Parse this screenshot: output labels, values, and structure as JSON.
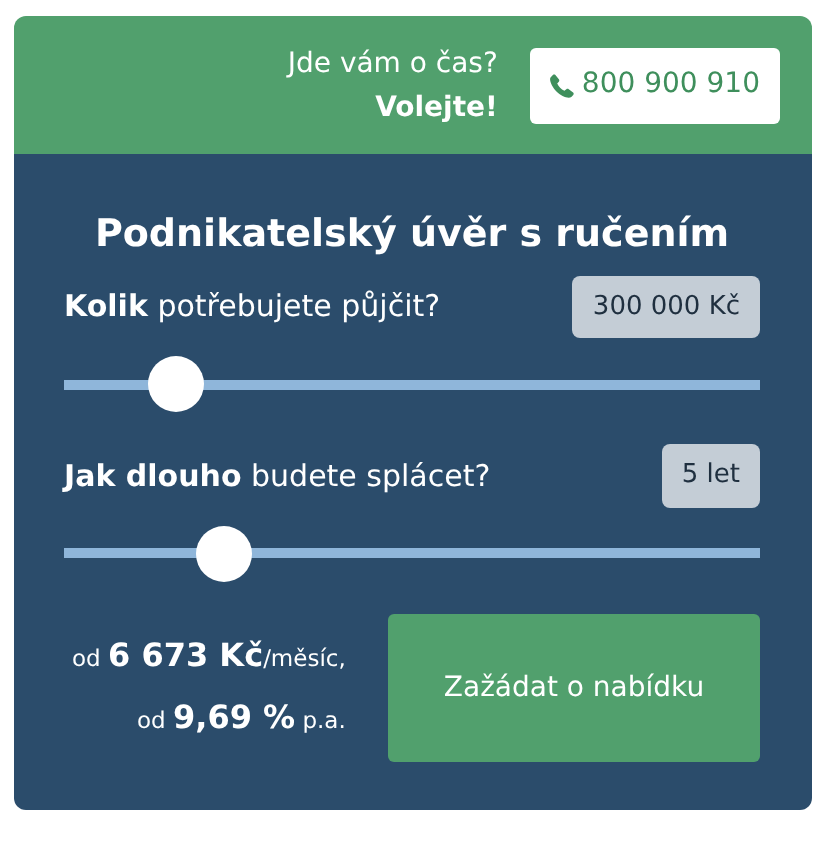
{
  "header": {
    "question": "Jde vám o čas?",
    "call_to_action": "Volejte!",
    "phone": "800 900 910"
  },
  "title": "Podnikatelský úvěr s ručením",
  "sliders": [
    {
      "label": "**Kolik** potřebujete půjčit?",
      "value": "300 000 Kč",
      "level": 0.16
    },
    {
      "label": "**Jak dlouho** budete splácet?",
      "value": "5 let",
      "level": 0.23
    }
  ],
  "summary": [
    {
      "prefix": "od",
      "amount": "6 673 Kč",
      "suffix": "/měsíc,"
    },
    {
      "prefix": "od",
      "amount": "9,69 %",
      "suffix": "p.a."
    }
  ],
  "button": "Zažádat o nabídku"
}
